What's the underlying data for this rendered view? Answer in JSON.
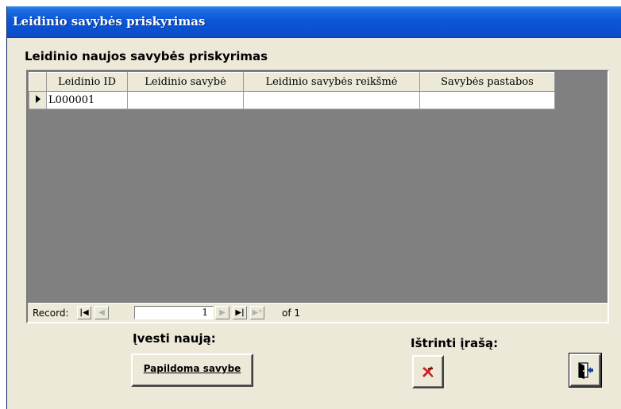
{
  "window": {
    "title": "Leidinio savybės priskyrimas"
  },
  "form": {
    "heading": "Leidinio naujos savybės priskyrimas"
  },
  "grid": {
    "columns": [
      "Leidinio ID",
      "Leidinio savybė",
      "Leidinio savybės reikšmė",
      "Savybės pastabos"
    ],
    "rows": [
      {
        "id": "L000001",
        "property": "",
        "value": "",
        "notes": ""
      }
    ]
  },
  "navigation": {
    "record_label": "Record:",
    "current": "1",
    "of_label": "of 1"
  },
  "actions": {
    "new_label": "Įvesti naują:",
    "new_button": "Papildoma savybe",
    "delete_label": "Ištrinti įrašą:",
    "delete_icon": "delete-record-icon",
    "exit_icon": "exit-door-icon"
  },
  "colors": {
    "titlebar": "#0a52d0",
    "form_bg": "#ece9d8",
    "grid_bg": "#808080",
    "delete_icon": "#cc2222"
  }
}
